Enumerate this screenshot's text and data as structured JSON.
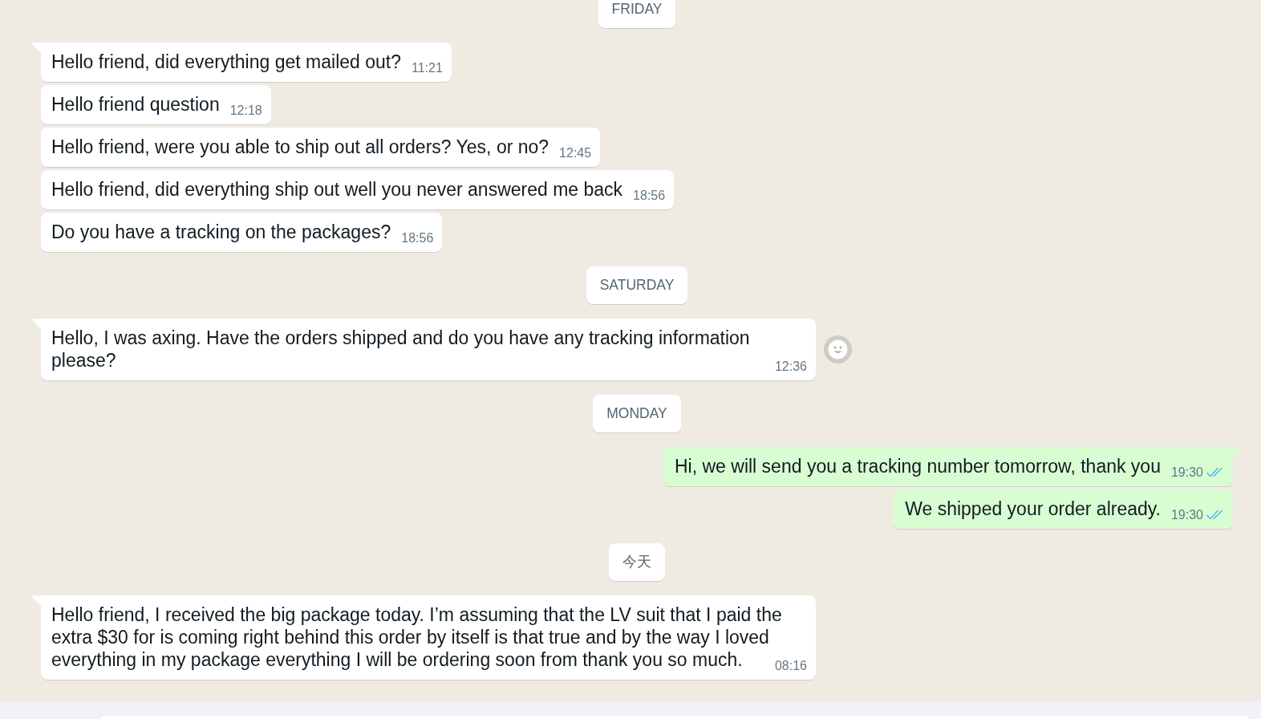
{
  "chat": {
    "items": [
      {
        "kind": "date",
        "label": "FRIDAY"
      },
      {
        "kind": "incoming",
        "tail": true,
        "text": "Hello friend, did everything get mailed out?",
        "time": "11:21"
      },
      {
        "kind": "incoming",
        "tail": false,
        "text": "Hello friend question",
        "time": "12:18"
      },
      {
        "kind": "incoming",
        "tail": false,
        "text": "Hello friend, were you able to ship out all orders? Yes, or no?",
        "time": "12:45"
      },
      {
        "kind": "incoming",
        "tail": false,
        "text": "Hello friend, did everything ship out well you never answered me back",
        "time": "18:56"
      },
      {
        "kind": "incoming",
        "tail": false,
        "text": "Do you have a tracking on the packages?",
        "time": "18:56"
      },
      {
        "kind": "date",
        "label": "SATURDAY"
      },
      {
        "kind": "incoming",
        "tail": true,
        "text": "Hello, I was axing. Have the orders shipped and do you have any tracking information please?",
        "time": "12:36",
        "reaction_button": true
      },
      {
        "kind": "date",
        "label": "MONDAY"
      },
      {
        "kind": "outgoing",
        "tail": true,
        "text": "Hi, we will send you a tracking number tomorrow, thank you",
        "time": "19:30",
        "read": true
      },
      {
        "kind": "outgoing",
        "tail": false,
        "text": "We shipped your order already.",
        "time": "19:30",
        "read": true
      },
      {
        "kind": "date",
        "label": "今天"
      },
      {
        "kind": "incoming",
        "tail": true,
        "text": "Hello friend, I received the big package today. I’m assuming that the LV suit that I paid the extra $30 for is coming right behind this order by itself is that true and by the way I loved everything in my package everything I will be ordering soon from thank you so much.",
        "time": "08:16"
      }
    ]
  }
}
